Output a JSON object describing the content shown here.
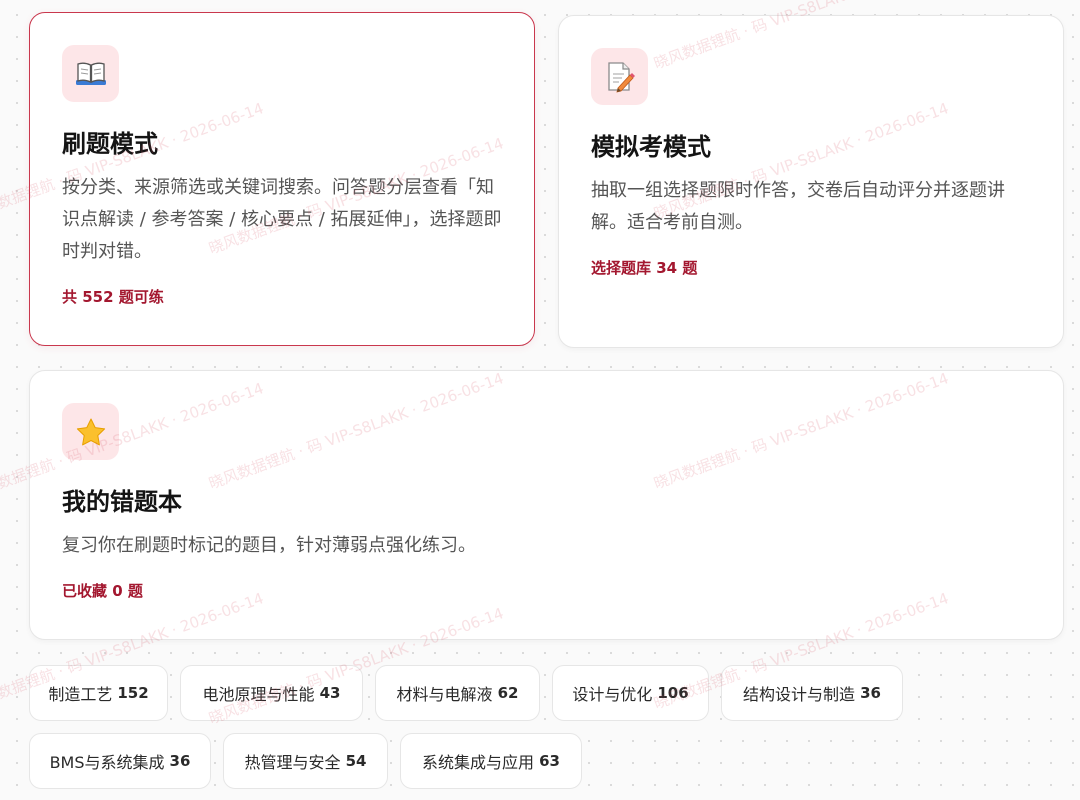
{
  "cards": {
    "practice": {
      "title": "刷题模式",
      "description": "按分类、来源筛选或关键词搜索。问答题分层查看「知识点解读 / 参考答案 / 核心要点 / 拓展延伸」，选择题即时判对错。",
      "count": "共 552 题可练",
      "icon": "open-book-icon"
    },
    "exam": {
      "title": "模拟考模式",
      "description": "抽取一组选择题限时作答，交卷后自动评分并逐题讲解。适合考前自测。",
      "count": "选择题库 34 题",
      "icon": "memo-pencil-icon"
    },
    "wrong": {
      "title": "我的错题本",
      "description": "复习你在刷题时标记的题目，针对薄弱点强化练习。",
      "count": "已收藏 0 题",
      "icon": "star-icon"
    }
  },
  "categories": [
    {
      "label": "制造工艺",
      "count": "152"
    },
    {
      "label": "电池原理与性能",
      "count": "43"
    },
    {
      "label": "材料与电解液",
      "count": "62"
    },
    {
      "label": "设计与优化",
      "count": "106"
    },
    {
      "label": "结构设计与制造",
      "count": "36"
    },
    {
      "label": "BMS与系统集成",
      "count": "36"
    },
    {
      "label": "热管理与安全",
      "count": "54"
    },
    {
      "label": "系统集成与应用",
      "count": "63"
    }
  ],
  "watermark": {
    "text": "晓风数据锂航 · 码 VIP-S8LAKK · 2026-06-14"
  },
  "colors": {
    "accent": "#a3172f",
    "active_border": "#c9374d",
    "icon_bg": "#fde6e8"
  }
}
